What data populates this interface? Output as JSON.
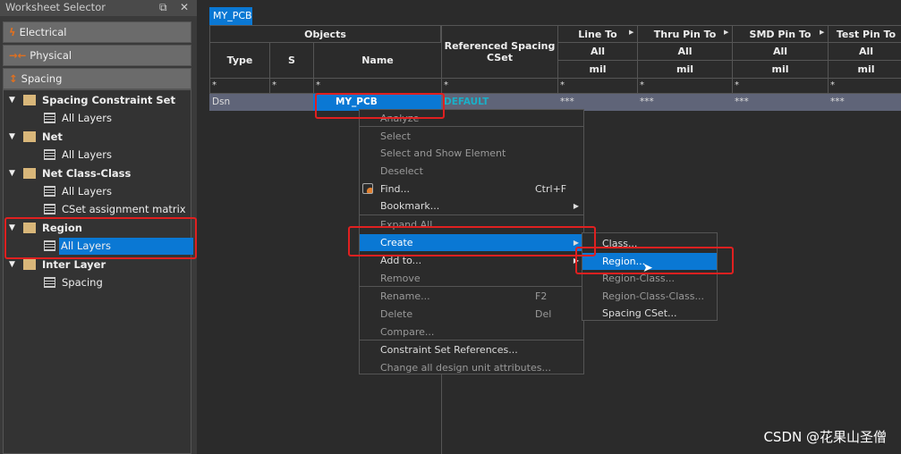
{
  "panel": {
    "title": "Worksheet Selector",
    "float_icon": "restore-icon",
    "close_icon": "close-icon",
    "categories": [
      {
        "label": "Electrical",
        "icon": "lightning-icon"
      },
      {
        "label": "Physical",
        "icon": "physical-arrows-icon"
      },
      {
        "label": "Spacing",
        "icon": "spacing-icon"
      }
    ],
    "tree": [
      {
        "label": "Spacing Constraint Set",
        "type": "folder"
      },
      {
        "label": "All Layers",
        "type": "sheet"
      },
      {
        "label": "Net",
        "type": "folder"
      },
      {
        "label": "All Layers",
        "type": "sheet"
      },
      {
        "label": "Net Class-Class",
        "type": "folder"
      },
      {
        "label": "All Layers",
        "type": "sheet"
      },
      {
        "label": "CSet assignment matrix",
        "type": "sheet"
      },
      {
        "label": "Region",
        "type": "folder"
      },
      {
        "label": "All Layers",
        "type": "sheet",
        "selected": true
      },
      {
        "label": "Inter Layer",
        "type": "folder"
      },
      {
        "label": "Spacing",
        "type": "sheet"
      }
    ]
  },
  "tab": "MY_PCB",
  "table": {
    "objects": "Objects",
    "type": "Type",
    "s": "S",
    "name": "Name",
    "ref": "Referenced Spacing CSet",
    "columns": [
      {
        "label": "Line To",
        "scope": "All",
        "unit": "mil"
      },
      {
        "label": "Thru Pin To",
        "scope": "All",
        "unit": "mil"
      },
      {
        "label": "SMD Pin To",
        "scope": "All",
        "unit": "mil"
      },
      {
        "label": "Test Pin To",
        "scope": "All",
        "unit": "mil"
      }
    ],
    "filter": "*",
    "row": {
      "type": "Dsn",
      "s": "",
      "name": "MY_PCB",
      "ref": "DEFAULT",
      "values": [
        "***",
        "***",
        "***",
        "***"
      ]
    }
  },
  "menu": [
    {
      "label": "Analyze",
      "enabled": false
    },
    {
      "label": "Select",
      "enabled": false
    },
    {
      "label": "Select and Show Element",
      "enabled": false
    },
    {
      "label": "Deselect",
      "enabled": false
    },
    {
      "label": "Find...",
      "enabled": true,
      "shortcut": "Ctrl+F"
    },
    {
      "label": "Bookmark...",
      "enabled": true,
      "submenu": true
    },
    {
      "label": "Expand All",
      "enabled": false
    },
    {
      "label": "Create",
      "enabled": true,
      "submenu": true,
      "highlighted": true
    },
    {
      "label": "Add to...",
      "enabled": true,
      "submenu": true
    },
    {
      "label": "Remove",
      "enabled": false
    },
    {
      "label": "Rename...",
      "enabled": false,
      "shortcut": "F2"
    },
    {
      "label": "Delete",
      "enabled": false,
      "shortcut": "Del"
    },
    {
      "label": "Compare...",
      "enabled": false
    },
    {
      "label": "Constraint Set References...",
      "enabled": true
    },
    {
      "label": "Change all design unit attributes...",
      "enabled": false
    }
  ],
  "submenu": [
    {
      "label": "Class...",
      "enabled": true
    },
    {
      "label": "Region...",
      "enabled": true,
      "highlighted": true
    },
    {
      "label": "Region-Class...",
      "enabled": false
    },
    {
      "label": "Region-Class-Class...",
      "enabled": false
    },
    {
      "label": "Spacing CSet...",
      "enabled": true
    }
  ],
  "watermark": "CSDN @花果山圣僧",
  "colors": {
    "accent": "#0a78d4",
    "annotation": "#e02020",
    "ref_text": "#1ab0c8"
  }
}
